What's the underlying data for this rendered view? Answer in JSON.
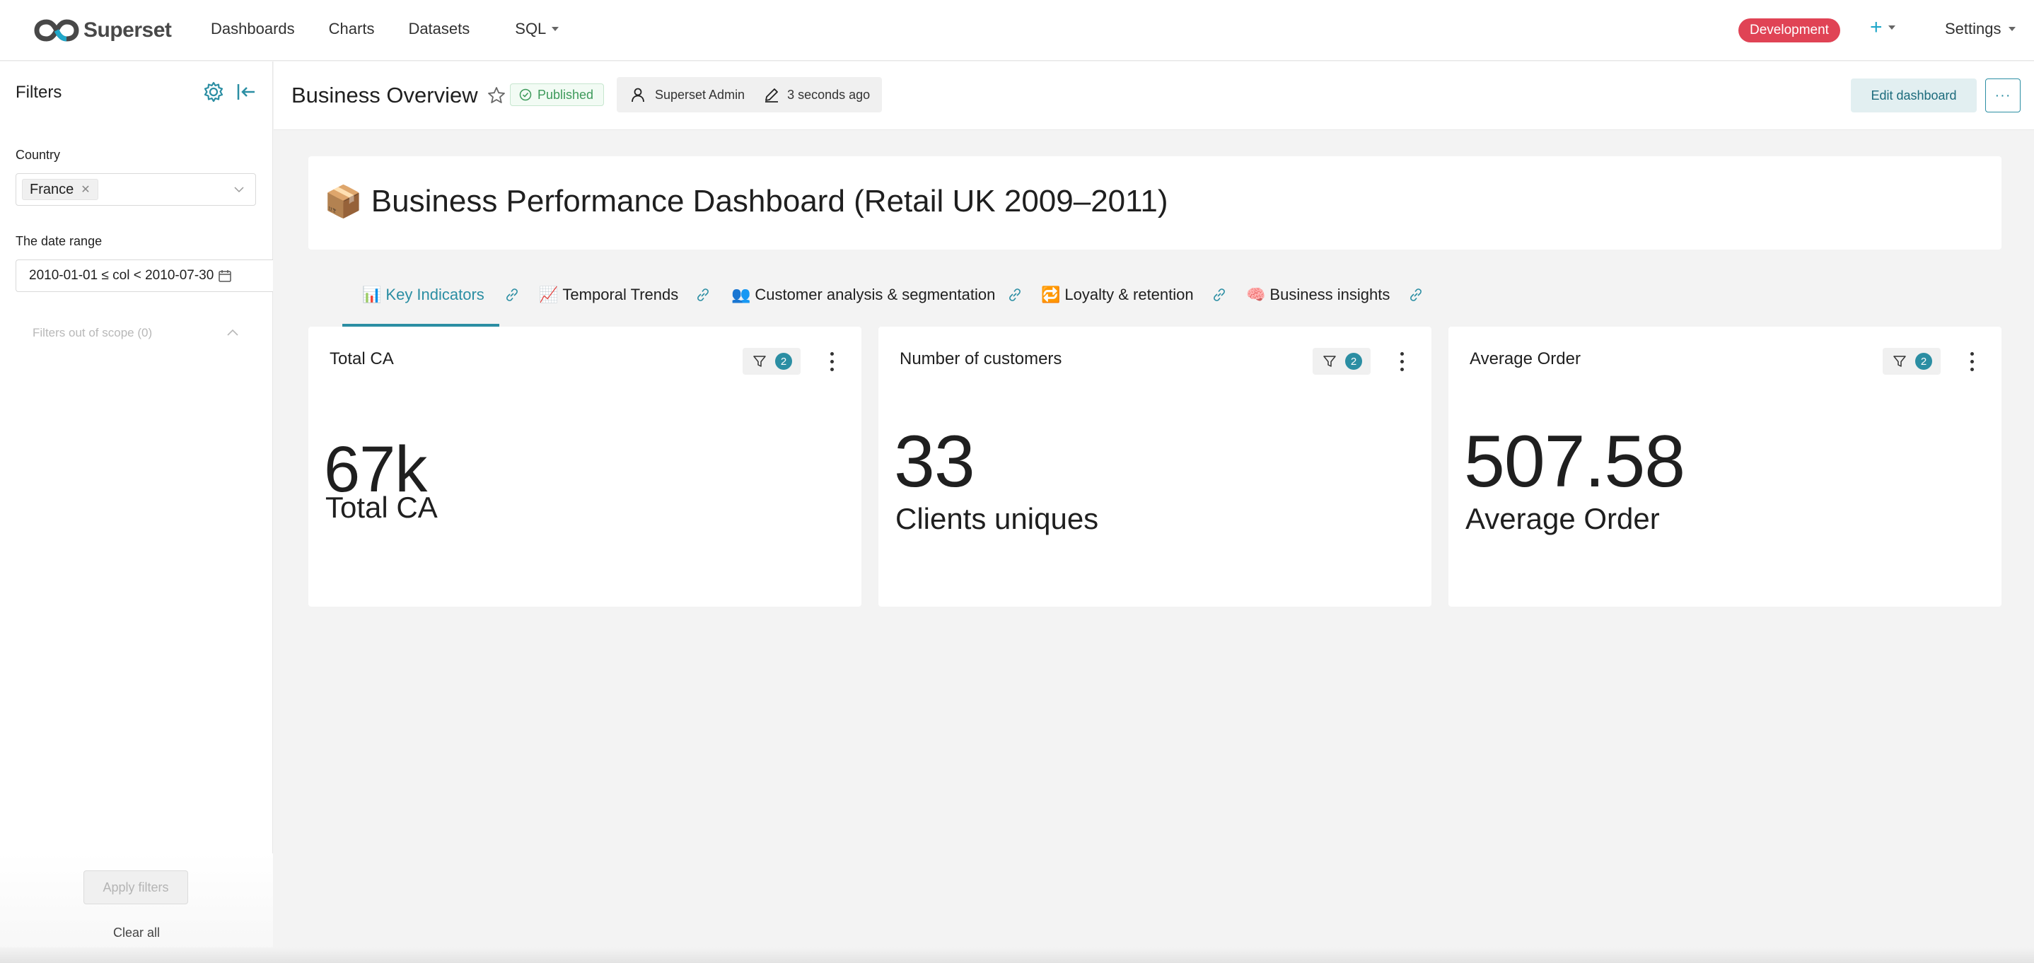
{
  "navbar": {
    "brand": "Superset",
    "links": [
      "Dashboards",
      "Charts",
      "Datasets"
    ],
    "sql_label": "SQL",
    "env_badge": "Development",
    "plus_label": "+",
    "settings_label": "Settings",
    "accent_color": "#20a7c9",
    "env_color": "#e04355"
  },
  "sidebar": {
    "title": "Filters",
    "country_label": "Country",
    "country_value": "France",
    "date_label": "The date range",
    "date_value": "2010-01-01 ≤ col < 2010-07-30",
    "out_of_scope": "Filters out of scope (0)",
    "apply_label": "Apply filters",
    "clear_label": "Clear all"
  },
  "header": {
    "title": "Business Overview",
    "status": "Published",
    "owner": "Superset Admin",
    "modified": "3 seconds ago",
    "edit_label": "Edit dashboard",
    "more_label": "···"
  },
  "markdown": {
    "emoji": "📦",
    "title": "Business Performance Dashboard (Retail UK 2009–2011)"
  },
  "tabs": [
    {
      "emoji": "📊",
      "label": "Key Indicators",
      "active": true
    },
    {
      "emoji": "📈",
      "label": "Temporal Trends",
      "active": false
    },
    {
      "emoji": "👥",
      "label": "Customer analysis & segmentation",
      "active": false
    },
    {
      "emoji": "🔁",
      "label": "Loyalty & retention",
      "active": false
    },
    {
      "emoji": "🧠",
      "label": "Business insights",
      "active": false
    }
  ],
  "cards": [
    {
      "title": "Total CA",
      "filter_count": "2",
      "value": "67k",
      "subheader": "Total CA"
    },
    {
      "title": "Number of customers",
      "filter_count": "2",
      "value": "33",
      "subheader": "Clients uniques"
    },
    {
      "title": "Average Order",
      "filter_count": "2",
      "value": "507.58",
      "subheader": "Average Order"
    }
  ]
}
